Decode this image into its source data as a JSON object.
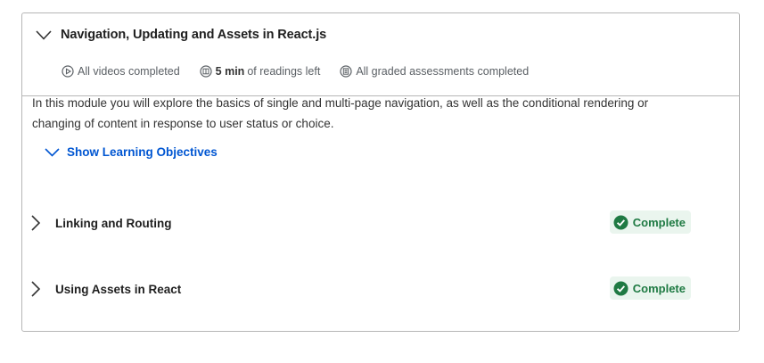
{
  "module": {
    "title": "Navigation, Updating and Assets in React.js",
    "stats": [
      {
        "icon": "play-circle-icon",
        "bold": "",
        "text": "All videos completed"
      },
      {
        "icon": "reading-icon",
        "bold": "5 min",
        "text": "of readings left"
      },
      {
        "icon": "assessment-icon",
        "bold": "",
        "text": "All graded assessments completed"
      }
    ],
    "description": "In this module you will explore the basics of single and multi-page navigation, as well as the conditional rendering or changing of content in response to user status or choice.",
    "objectives_label": "Show Learning Objectives",
    "lessons": [
      {
        "title": "Linking and Routing",
        "status": "Complete"
      },
      {
        "title": "Using Assets in React",
        "status": "Complete"
      }
    ]
  },
  "colors": {
    "link": "#0056d2",
    "success_text": "#1f7a43",
    "success_bg": "#eaf5ee",
    "border": "#b6b6b6"
  }
}
